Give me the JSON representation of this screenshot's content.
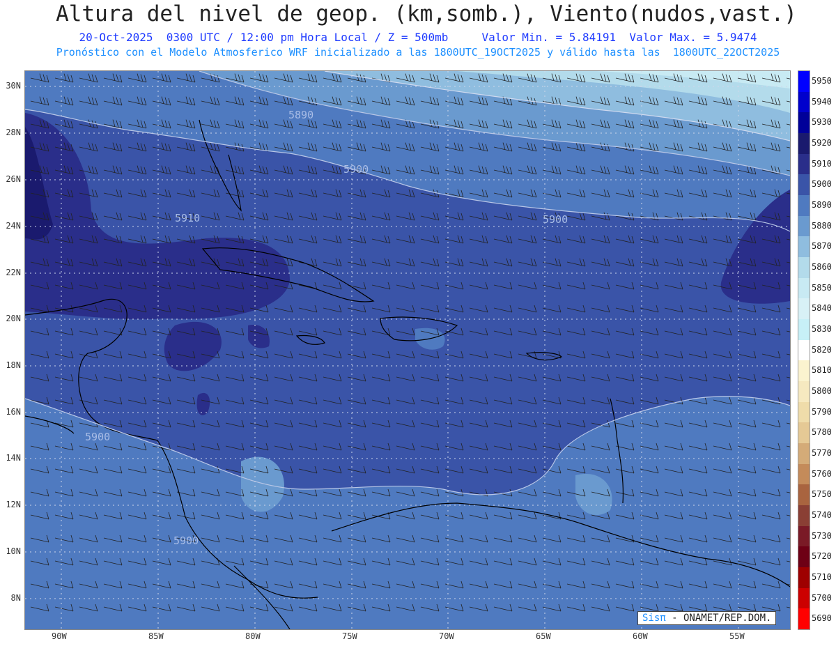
{
  "header": {
    "title": "Altura del nivel de geop. (km,somb.), Viento(nudos,vast.)",
    "line1": "20-Oct-2025  0300 UTC / 12:00 pm Hora Local / Z = 500mb     Valor Min. = 5.84191  Valor Max. = 5.9474",
    "line2": "Pronóstico con el Modelo Atmosferico WRF inicializado a las 1800UTC_19OCT2025 y válido hasta las  1800UTC_22OCT2025"
  },
  "map": {
    "lat_labels": [
      "30N",
      "28N",
      "26N",
      "24N",
      "22N",
      "20N",
      "18N",
      "16N",
      "14N",
      "12N",
      "10N",
      "8N"
    ],
    "lon_labels": [
      "90W",
      "85W",
      "80W",
      "75W",
      "70W",
      "65W",
      "60W",
      "55W"
    ],
    "contour_labels": [
      "5890",
      "5900",
      "5910",
      "5900",
      "5900",
      "5900"
    ]
  },
  "colorbar": {
    "labels": [
      "5950",
      "5940",
      "5930",
      "5920",
      "5910",
      "5900",
      "5890",
      "5880",
      "5870",
      "5860",
      "5850",
      "5840",
      "5830",
      "5820",
      "5810",
      "5800",
      "5790",
      "5780",
      "5770",
      "5760",
      "5750",
      "5740",
      "5730",
      "5720",
      "5710",
      "5700",
      "5690"
    ],
    "colors": [
      "#0000ff",
      "#0000cc",
      "#000099",
      "#1a1a6e",
      "#2a2e8a",
      "#3a54a8",
      "#4f7ac0",
      "#6a9acf",
      "#8fbddf",
      "#b3dbeb",
      "#c8eaf3",
      "#d8f1f6",
      "#c7f0f7",
      "#ffffff",
      "#fbf3cf",
      "#f6e9c0",
      "#efdcaa",
      "#e5c995",
      "#d4ab78",
      "#c48b5a",
      "#a9643f",
      "#8a3f34",
      "#7a1a26",
      "#6e0015",
      "#9e0000",
      "#cc0000",
      "#ff0000"
    ]
  },
  "credit": {
    "brand": "Sisπ",
    "text": " - ONAMET/REP.DOM."
  }
}
